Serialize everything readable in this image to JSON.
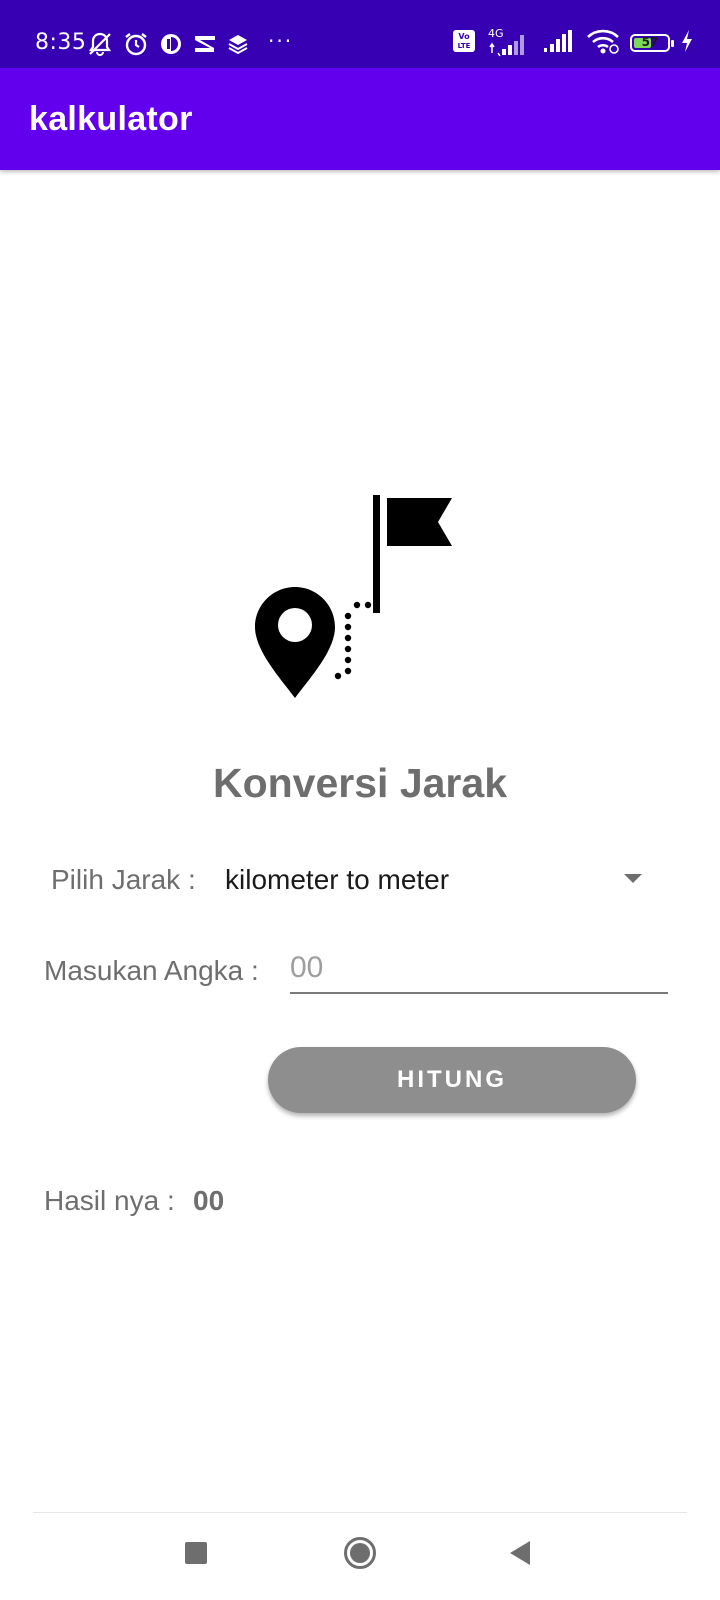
{
  "status_bar": {
    "time": "8:35",
    "more_indicator": "···",
    "network_type": "4G",
    "volte_label": "Vo\nLTE",
    "battery_level": "57",
    "battery_percent": 57,
    "icons_left": [
      "mute-icon",
      "alarm-icon",
      "app-notification-icon",
      "capcut-icon",
      "layers-icon"
    ],
    "icons_right": [
      "volte-icon",
      "signal-4g-icon",
      "signal-icon",
      "wifi-icon",
      "battery-icon",
      "charging-icon"
    ],
    "background_color": "#3700b3"
  },
  "app_bar": {
    "title": "kalkulator",
    "background_color": "#6200ee"
  },
  "main": {
    "hero_icon": "distance-pin-flag-icon",
    "title": "Konversi Jarak",
    "pilih_jarak_label": "Pilih Jarak :",
    "selected_conversion": "kilometer to meter",
    "masukan_angka_label": "Masukan Angka :",
    "input_placeholder": "00",
    "input_value": "",
    "button_label": "HITUNG",
    "result_label": "Hasil nya :",
    "result_value": "00"
  },
  "nav_bar": {
    "buttons": [
      "recents-icon",
      "home-icon",
      "back-icon"
    ]
  }
}
